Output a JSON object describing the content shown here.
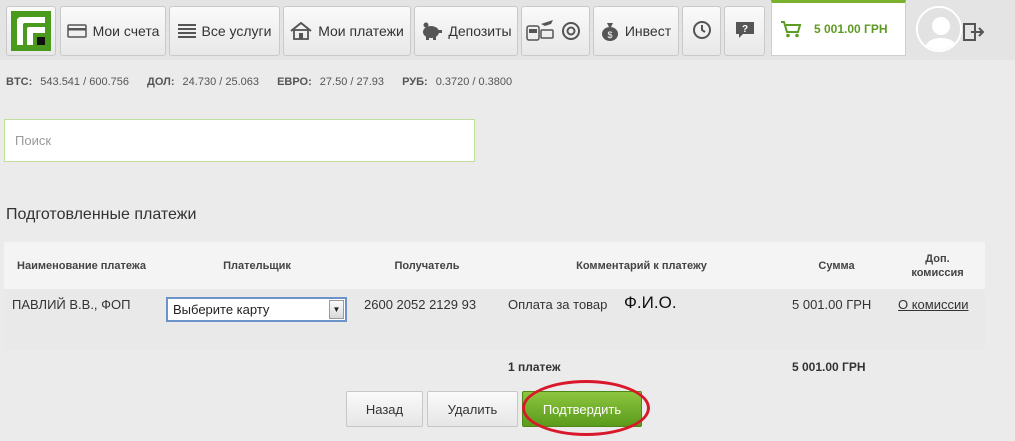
{
  "nav": {
    "items": [
      {
        "label": "Мои счета",
        "icon": "card-icon"
      },
      {
        "label": "Все услуги",
        "icon": "list-icon"
      },
      {
        "label": "Мои платежи",
        "icon": "house-icon"
      },
      {
        "label": "Депозиты",
        "icon": "piggy-bank-icon"
      },
      {
        "label": "Инвест",
        "icon": "money-bag-icon"
      }
    ],
    "cart_amount": "5 001.00 ГРН"
  },
  "rates": [
    {
      "key": "BTC:",
      "value": "543.541 / 600.756"
    },
    {
      "key": "ДОЛ:",
      "value": "24.730 / 25.063"
    },
    {
      "key": "ЕВРО:",
      "value": "27.50 / 27.93"
    },
    {
      "key": "РУБ:",
      "value": "0.3720 / 0.3800"
    }
  ],
  "search": {
    "placeholder": "Поиск"
  },
  "section_title": "Подготовленные платежи",
  "table": {
    "headers": [
      "Наименование платежа",
      "Плательщик",
      "Получатель",
      "Комментарий к платежу",
      "Сумма",
      "Доп. комиссия"
    ],
    "row": {
      "name": "ПАВЛИЙ В.В., ФОП",
      "payer_select": "Выберите карту",
      "recipient": "2600 2052 2129 93",
      "comment": "Оплата за товар",
      "comment_extra": "Ф.И.О.",
      "amount": "5 001.00 ГРН",
      "commission_link": "О комиссии"
    },
    "total_count": "1 платеж",
    "total_amount": "5 001.00 ГРН"
  },
  "buttons": {
    "back": "Назад",
    "delete": "Удалить",
    "confirm": "Подтвердить"
  },
  "colors": {
    "accent_green": "#5e9b22",
    "highlight_red": "#d9192b"
  }
}
